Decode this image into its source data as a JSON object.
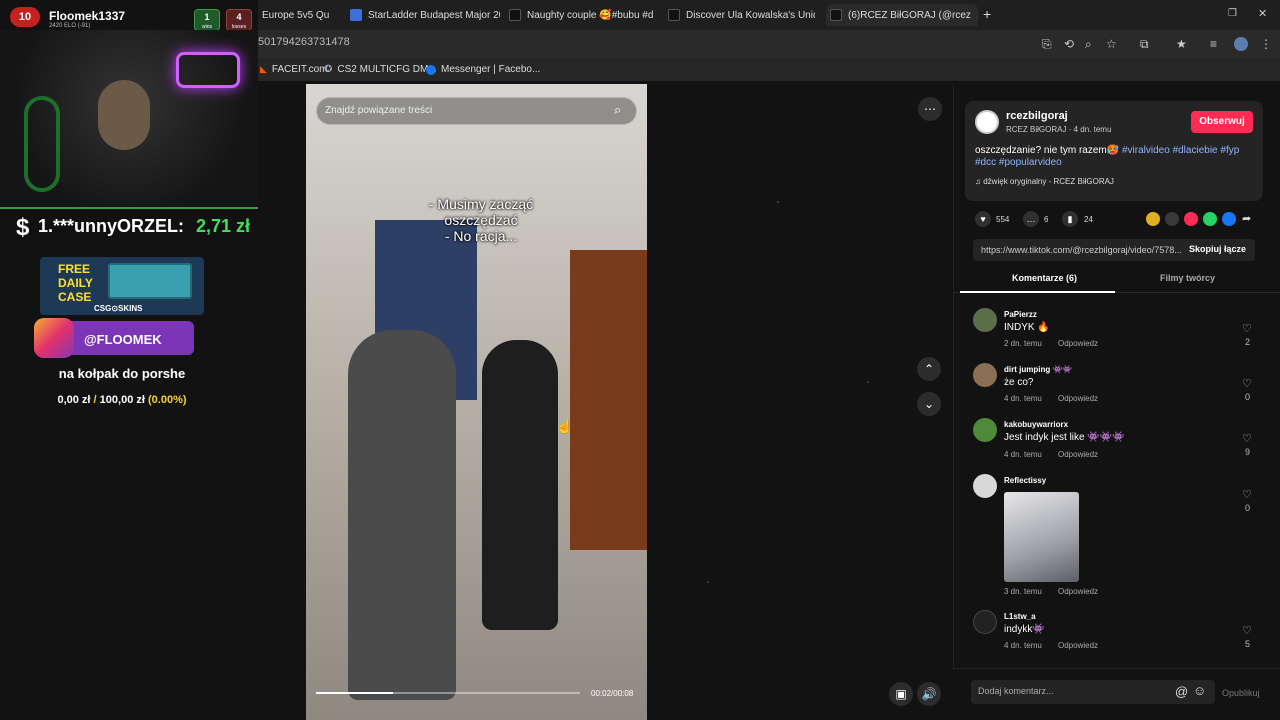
{
  "browser": {
    "tabs": [
      {
        "label": "Europe 5v5 Qu",
        "color": "#f5f5f5"
      },
      {
        "label": "StarLadder Budapest Major 202",
        "color": "#3d6fd8"
      },
      {
        "label": "Naughty couple 🥰#bubu #du",
        "color": "#111111"
      },
      {
        "label": "Discover Ula Kowalska's Uniqu",
        "color": "#111111"
      },
      {
        "label": "(6)RCEZ BiłGORAJ (@rcez",
        "color": "#111111"
      }
    ],
    "new_tab": "+",
    "url": "501794263731478",
    "bookmarks": [
      "FACEIT.com",
      "CS2 MULTICFG DM...",
      "Messenger | Facebo..."
    ]
  },
  "stream_overlay": {
    "faceit_level": "10",
    "player": "Floomek1337",
    "elo": "2420 ELO (-91)",
    "wins": {
      "value": "1",
      "label": "wins"
    },
    "losses": {
      "value": "4",
      "label": "losses"
    },
    "donation": {
      "symbol": "$",
      "name": "1.***unnyORZEL:",
      "amount": "2,71 zł"
    },
    "case_ad": {
      "line1": "FREE",
      "line2": "DAILY",
      "line3": "CASE",
      "brand": "CSG⊙SKINS"
    },
    "instagram": "@FLOOMEK",
    "goal_label": "na kołpak do porshe",
    "goal_current": "0,00 zł",
    "goal_sep": "/",
    "goal_target": "100,00 zł",
    "goal_percent": "(0.00%)"
  },
  "video": {
    "search_placeholder": "Znajdź powiązane treści",
    "caption_lines": [
      "- Musimy zacząć",
      "oszczędzać",
      "- No racja..."
    ],
    "progress_fraction": 0.29,
    "time": "00:02/00:08"
  },
  "post": {
    "handle": "rcezbilgoraj",
    "display_name": "RCEZ BiłGORAJ",
    "age": "4 dn. temu",
    "follow_label": "Obserwuj",
    "description_text": "oszczędzanie? nie tym razem🥵",
    "hashtags": [
      "#viralvideo",
      "#dlaciebie",
      "#fyp",
      "#dcc",
      "#popularvideo"
    ],
    "sound": "dźwięk oryginalny - RCEZ BiłGORAJ",
    "likes": "554",
    "comments": "6",
    "saves": "24",
    "link": "https://www.tiktok.com/@rcezbilgoraj/video/7578...",
    "copy_label": "Skopiuj łącze",
    "tab_comments": "Komentarze (6)",
    "tab_creator": "Filmy twórcy"
  },
  "comments": [
    {
      "user": "PaPierzz",
      "text": "INDYK 🔥",
      "time": "2 dn. temu",
      "reply": "Odpowiedz",
      "likes": "2",
      "avatar_color": "#5b6e4a"
    },
    {
      "user": "dirt jumping 👾👾",
      "text": "że co?",
      "time": "4 dn. temu",
      "reply": "Odpowiedz",
      "likes": "0",
      "avatar_color": "#8a6f55"
    },
    {
      "user": "kakobuywarriorx",
      "text": "Jest indyk jest like 👾👾👾",
      "time": "4 dn. temu",
      "reply": "Odpowiedz",
      "likes": "9",
      "avatar_color": "#4f8a3a"
    },
    {
      "user": "Reflectissy",
      "text": "",
      "time": "3 dn. temu",
      "reply": "Odpowiedz",
      "likes": "0",
      "avatar_color": "#d8d8d8"
    },
    {
      "user": "L1stw_a",
      "text": "indykk👾",
      "time": "4 dn. temu",
      "reply": "Odpowiedz",
      "likes": "5",
      "avatar_color": "#222222"
    }
  ],
  "comment_input": {
    "placeholder": "Dodaj komentarz...",
    "post_label": "Opublikuj"
  }
}
